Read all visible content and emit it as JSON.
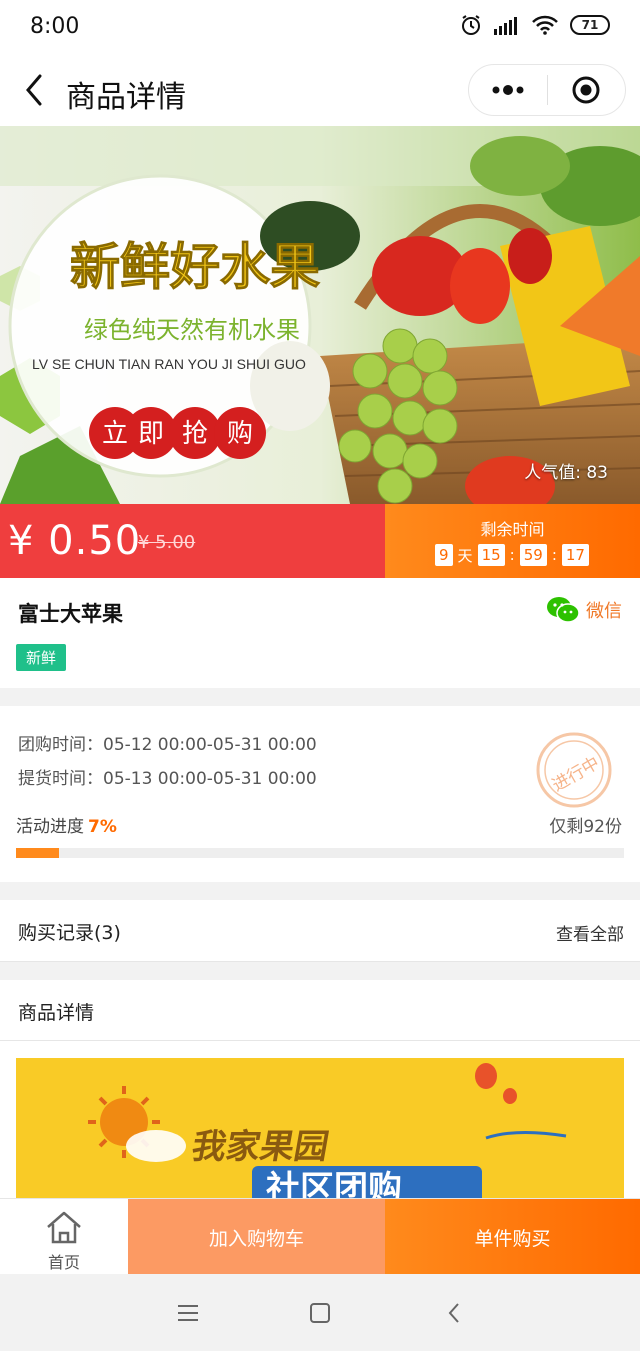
{
  "status": {
    "time": "8:00",
    "battery": "71"
  },
  "nav": {
    "title": "商品详情"
  },
  "banner": {
    "headline": "新鲜好水果",
    "subline": "绿色纯天然有机水果",
    "pinyin": "LV SE CHUN TIAN RAN YOU JI SHUI GUO",
    "cta_chars": [
      "立",
      "即",
      "抢",
      "购"
    ],
    "popularity": "人气值: 83"
  },
  "price": {
    "current": "¥ 0.50",
    "original": "¥ 5.00",
    "remain_title": "剩余时间",
    "days": "9",
    "day_unit": "天",
    "hours": "15",
    "minutes": "59",
    "seconds": "17",
    "sep": ":"
  },
  "product": {
    "name": "富士大苹果",
    "share_label": "微信",
    "tag": "新鲜"
  },
  "activity": {
    "group_time": "团购时间：05-12 00:00-05-31 00:00",
    "pickup_time": "提货时间：05-13 00:00-05-31 00:00",
    "progress_label": "活动进度",
    "progress_percent": "7%",
    "progress_value": 0.07,
    "remaining": "仅剩92份",
    "stamp_text": "进行中"
  },
  "records": {
    "title": "购买记录(3)",
    "view_all": "查看全部"
  },
  "details": {
    "title": "商品详情",
    "banner_line1": "我家果园",
    "banner_line2": "社区团购"
  },
  "bottom": {
    "home": "首页",
    "add_cart": "加入购物车",
    "buy": "单件购买"
  },
  "colors": {
    "price_red": "#ef3e3e",
    "accent_orange": "#ff6a00",
    "tag_green": "#1fc08a"
  }
}
